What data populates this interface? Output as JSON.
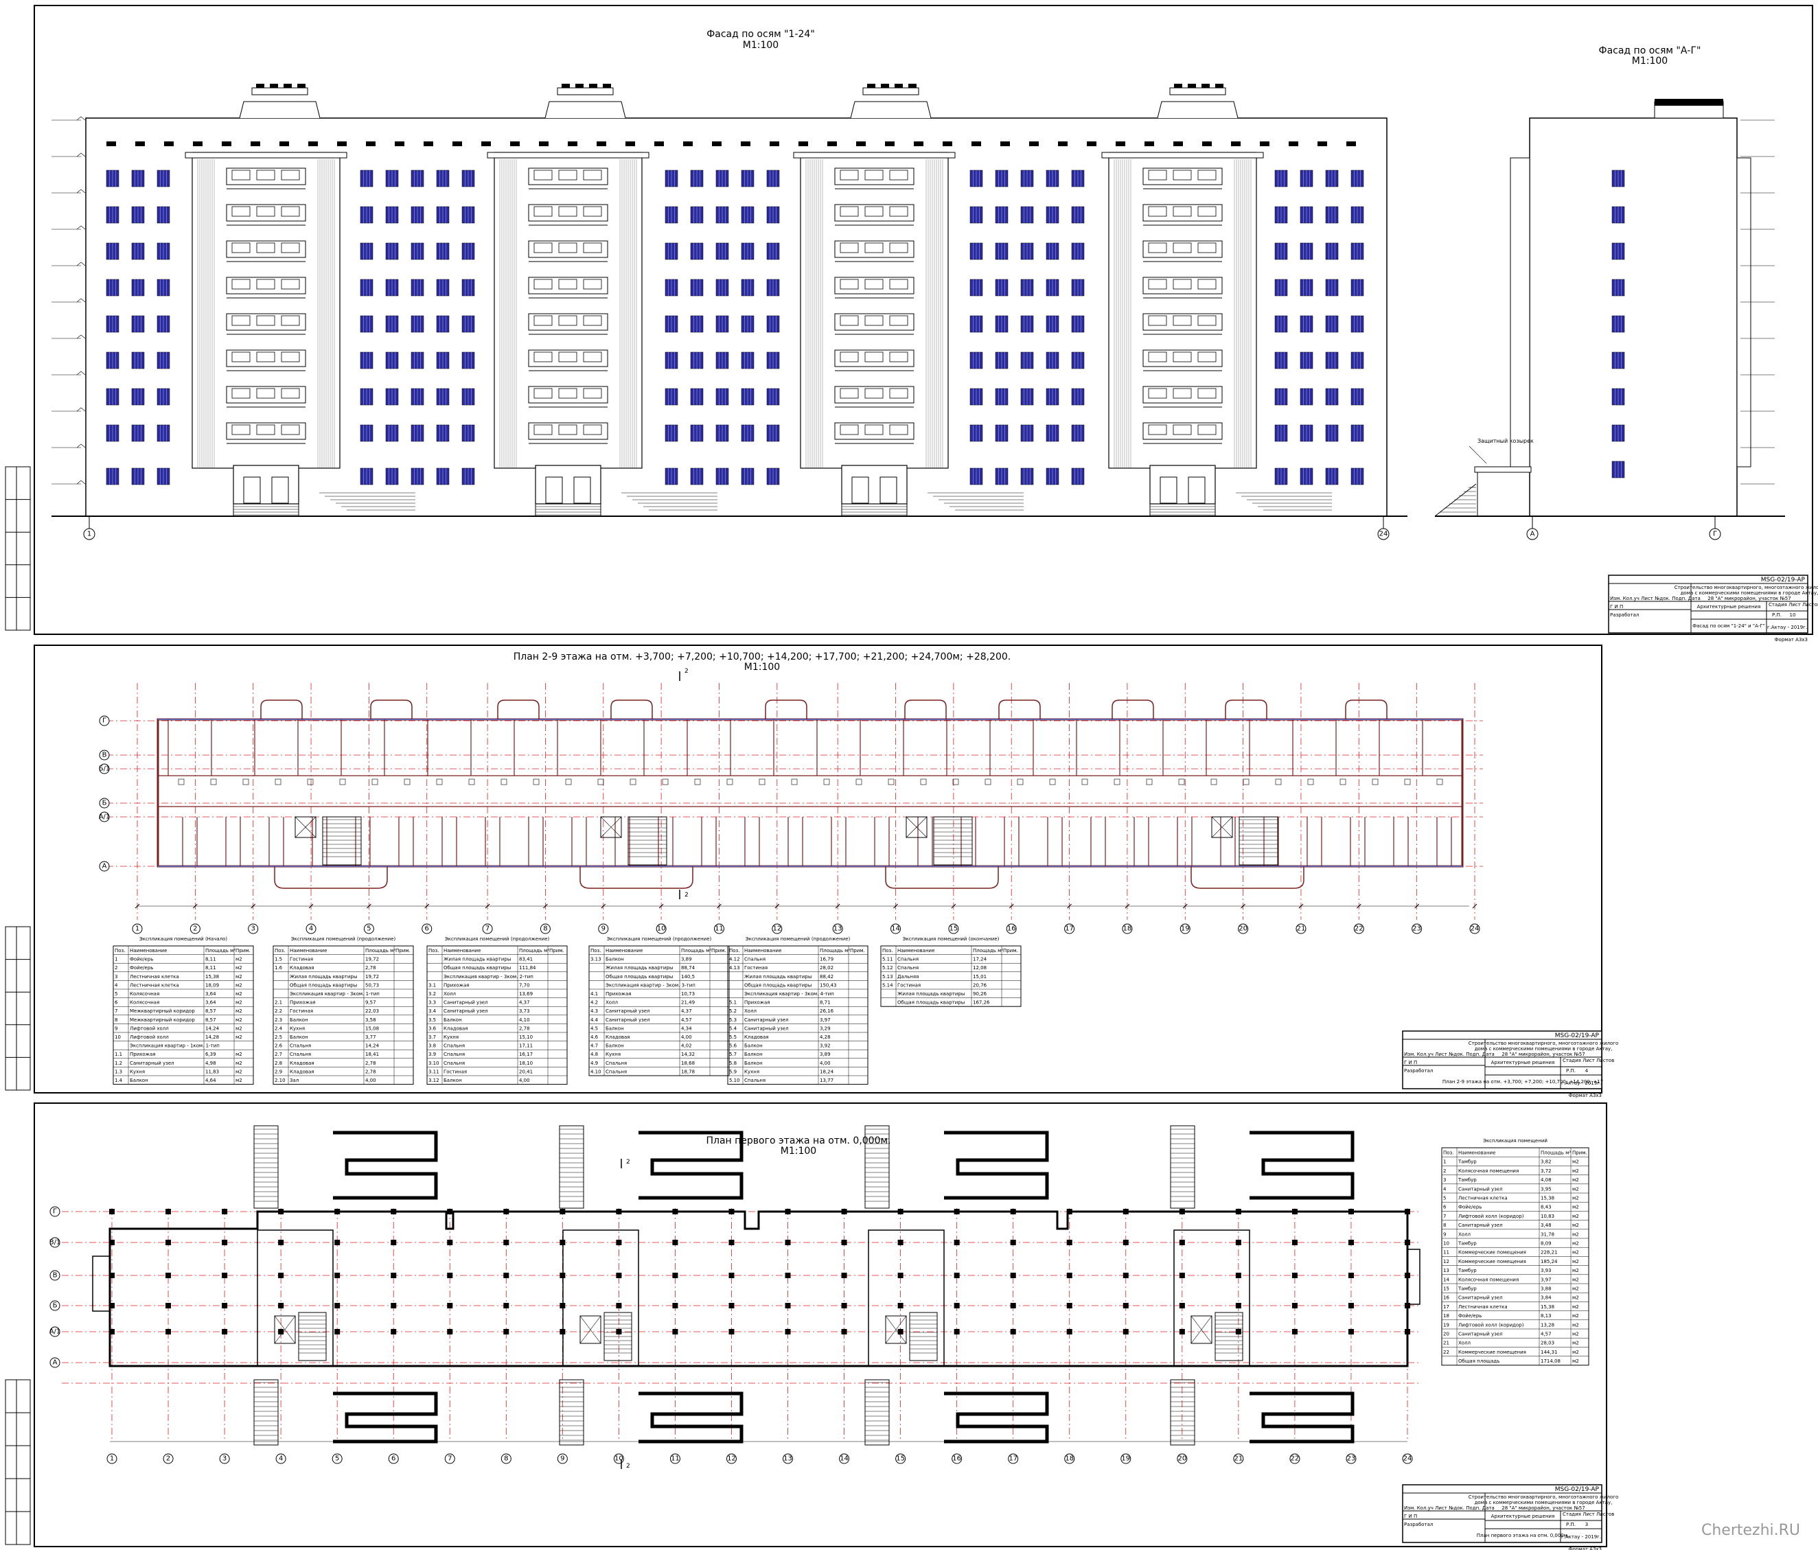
{
  "sheets": {
    "facade": {
      "title_main": "Фасад по осям \"1-24\"",
      "title_scale": "М1:100",
      "title_side": "Фасад по осям \"А-Г\"",
      "title_side_scale": "М1:100",
      "axis_left": "1",
      "axis_right": "24",
      "axis_side_left": "А",
      "axis_side_right": "Г",
      "canopy_label": "Защитный козырек",
      "titleblock": {
        "code": "MSG-02/19-AP",
        "desc1": "Строительство многоквартирного, многоэтажного жилого",
        "desc2": "дома с коммерческими помещениями в городе Актау,",
        "desc3": "28 \"А\" микрорайон, участок №57",
        "section": "Архитектурные решения",
        "stage": "Р.П.",
        "sheet": "10",
        "sheet_name": "Фасад по осям \"1-24\" и \"А-Г\"",
        "company": "г.Актау - 2019г.",
        "format": "Формат А3х3",
        "developed": "Разработал"
      }
    },
    "plan_typical": {
      "title_main": "План 2-9 этажа на отм. +3,700; +7,200; +10,700; +14,200; +17,700; +21,200; +24,700м; +28,200.",
      "title_scale": "М1:100",
      "cut_label": "2",
      "axes_bottom": [
        "1",
        "2",
        "3",
        "4",
        "5",
        "6",
        "7",
        "8",
        "9",
        "10",
        "11",
        "12",
        "13",
        "14",
        "15",
        "16",
        "17",
        "18",
        "19",
        "20",
        "21",
        "22",
        "23",
        "24"
      ],
      "axes_left": [
        "Г",
        "В",
        "Б/1",
        "Б",
        "А/1",
        "А"
      ],
      "tables": [
        {
          "title": "Экспликация помещений (Начало)",
          "headers": [
            "Поз.",
            "Наименование",
            "Площадь м²",
            "Прим."
          ],
          "rows": [
            [
              "1",
              "Фойе/ерь",
              "8,11",
              "м2"
            ],
            [
              "2",
              "Фойе/ерь",
              "8,11",
              "м2"
            ],
            [
              "3",
              "Лестничная клетка",
              "15,38",
              "м2"
            ],
            [
              "4",
              "Лестничная клетка",
              "18,09",
              "м2"
            ],
            [
              "5",
              "Колясочная",
              "3,64",
              "м2"
            ],
            [
              "6",
              "Колясочная",
              "3,64",
              "м2"
            ],
            [
              "7",
              "Межквартирный коридор",
              "8,57",
              "м2"
            ],
            [
              "8",
              "Межквартирный коридор",
              "8,57",
              "м2"
            ],
            [
              "9",
              "Лифтовой холл",
              "14,24",
              "м2"
            ],
            [
              "10",
              "Лифтовой холл",
              "14,28",
              "м2"
            ],
            [
              "",
              "Экспликация квартир - 1ком. 1-тип",
              "",
              ""
            ],
            [
              "1.1",
              "Прихожая",
              "6,39",
              "м2"
            ],
            [
              "1.2",
              "Санитарный узел",
              "4,98",
              "м2"
            ],
            [
              "1.3",
              "Кухня",
              "11,83",
              "м2"
            ],
            [
              "1.4",
              "Балкон",
              "4,64",
              "м2"
            ]
          ]
        },
        {
          "title": "Экспликация помещений (продолжение)",
          "headers": [
            "Поз.",
            "Наименование",
            "Площадь м²",
            "Прим."
          ],
          "rows": [
            [
              "1.5",
              "Гостиная",
              "19,72",
              ""
            ],
            [
              "1.6",
              "Кладовая",
              "2,78",
              ""
            ],
            [
              "",
              "Жилая площадь квартиры",
              "19,72",
              ""
            ],
            [
              "",
              "Общая площадь квартиры",
              "50,73",
              ""
            ],
            [
              "",
              "Экспликация квартир - 3ком. 1-тип",
              "",
              ""
            ],
            [
              "2.1",
              "Прихожая",
              "9,57",
              ""
            ],
            [
              "2.2",
              "Гостиная",
              "22,03",
              ""
            ],
            [
              "2.3",
              "Балкон",
              "3,58",
              ""
            ],
            [
              "2.4",
              "Кухня",
              "15,08",
              ""
            ],
            [
              "2.5",
              "Балкон",
              "3,77",
              ""
            ],
            [
              "2.6",
              "Спальня",
              "14,24",
              ""
            ],
            [
              "2.7",
              "Спальня",
              "18,41",
              ""
            ],
            [
              "2.8",
              "Кладовая",
              "2,78",
              ""
            ],
            [
              "2.9",
              "Кладовая",
              "2,78",
              ""
            ],
            [
              "2.10",
              "Зал",
              "4,00",
              ""
            ]
          ]
        },
        {
          "title": "Экспликация помещений (продолжение)",
          "headers": [
            "Поз.",
            "Наименование",
            "Площадь м²",
            "Прим."
          ],
          "rows": [
            [
              "",
              "Жилая площадь квартиры",
              "83,41",
              ""
            ],
            [
              "",
              "Общая площадь квартиры",
              "111,84",
              ""
            ],
            [
              "",
              "Экспликация квартир - 3ком. 2-тип",
              "",
              ""
            ],
            [
              "3.1",
              "Прихожая",
              "7,70",
              ""
            ],
            [
              "3.2",
              "Холл",
              "13,69",
              ""
            ],
            [
              "3.3",
              "Санитарный узел",
              "4,37",
              ""
            ],
            [
              "3.4",
              "Санитарный узел",
              "3,73",
              ""
            ],
            [
              "3.5",
              "Балкон",
              "4,10",
              ""
            ],
            [
              "3.6",
              "Кладовая",
              "2,78",
              ""
            ],
            [
              "3.7",
              "Кухня",
              "15,10",
              ""
            ],
            [
              "3.8",
              "Спальня",
              "17,11",
              ""
            ],
            [
              "3.9",
              "Спальня",
              "16,17",
              ""
            ],
            [
              "3.10",
              "Спальня",
              "18,10",
              ""
            ],
            [
              "3.11",
              "Гостиная",
              "20,41",
              ""
            ],
            [
              "3.12",
              "Балкон",
              "4,00",
              ""
            ]
          ]
        },
        {
          "title": "Экспликация помещений (продолжение)",
          "headers": [
            "Поз.",
            "Наименование",
            "Площадь м²",
            "Прим."
          ],
          "rows": [
            [
              "3.13",
              "Балкон",
              "3,89",
              ""
            ],
            [
              "",
              "Жилая площадь квартиры",
              "88,74",
              ""
            ],
            [
              "",
              "Общая площадь квартиры",
              "140,5",
              ""
            ],
            [
              "",
              "Экспликация квартир - 3ком. 3-тип",
              "",
              ""
            ],
            [
              "4.1",
              "Прихожая",
              "10,73",
              ""
            ],
            [
              "4.2",
              "Холл",
              "21,49",
              ""
            ],
            [
              "4.3",
              "Санитарный узел",
              "4,37",
              ""
            ],
            [
              "4.4",
              "Санитарный узел",
              "4,57",
              ""
            ],
            [
              "4.5",
              "Балкон",
              "4,34",
              ""
            ],
            [
              "4.6",
              "Кладовая",
              "4,00",
              ""
            ],
            [
              "4.7",
              "Балкон",
              "4,02",
              ""
            ],
            [
              "4.8",
              "Кухня",
              "14,32",
              ""
            ],
            [
              "4.9",
              "Спальня",
              "18,68",
              ""
            ],
            [
              "4.10",
              "Спальня",
              "18,78",
              ""
            ]
          ]
        },
        {
          "title": "Экспликация помещений (продолжение)",
          "headers": [
            "Поз.",
            "Наименование",
            "Площадь м²",
            "Прим."
          ],
          "rows": [
            [
              "4.12",
              "Спальня",
              "16,79",
              ""
            ],
            [
              "4.13",
              "Гостиная",
              "28,02",
              ""
            ],
            [
              "",
              "Жилая площадь квартиры",
              "88,42",
              ""
            ],
            [
              "",
              "Общая площадь квартиры",
              "150,43",
              ""
            ],
            [
              "",
              "Экспликация квартир - 3ком. 4-тип",
              "",
              ""
            ],
            [
              "5.1",
              "Прихожая",
              "8,71",
              ""
            ],
            [
              "5.2",
              "Холл",
              "26,16",
              ""
            ],
            [
              "5.3",
              "Санитарный узел",
              "3,97",
              ""
            ],
            [
              "5.4",
              "Санитарный узел",
              "3,29",
              ""
            ],
            [
              "5.5",
              "Кладовая",
              "4,28",
              ""
            ],
            [
              "5.6",
              "Балкон",
              "3,92",
              ""
            ],
            [
              "5.7",
              "Балкон",
              "3,89",
              ""
            ],
            [
              "5.8",
              "Балкон",
              "4,00",
              ""
            ],
            [
              "5.9",
              "Кухня",
              "18,24",
              ""
            ],
            [
              "5.10",
              "Спальня",
              "13,77",
              ""
            ]
          ]
        },
        {
          "title": "Экспликация помещений (окончание)",
          "headers": [
            "Поз.",
            "Наименование",
            "Площадь м²",
            "Прим."
          ],
          "rows": [
            [
              "5.11",
              "Спальня",
              "17,24",
              ""
            ],
            [
              "5.12",
              "Спальня",
              "12,08",
              ""
            ],
            [
              "5.13",
              "Дальняя",
              "15,01",
              ""
            ],
            [
              "5.14",
              "Гостиная",
              "20,76",
              ""
            ],
            [
              "",
              "Жилая площадь квартиры",
              "90,26",
              ""
            ],
            [
              "",
              "Общая площадь квартиры",
              "167,26",
              ""
            ]
          ]
        }
      ],
      "titleblock": {
        "code": "MSG-02/19-AP",
        "desc1": "Строительство многоквартирного, многоэтажного жилого",
        "desc2": "дома с коммерческими помещениями в городе Актау,",
        "desc3": "28 \"А\" микрорайон, участок №57",
        "section": "Архитектурные решения",
        "stage": "Р.П.",
        "sheet": "4",
        "sheet_name": "План 2-9 этажа на отм. +3,700; +7,200; +10,700; +14,200; +17,700; +21,200; +24,700м; +28,200.",
        "company": "г.Актау - 2019г.",
        "format": "Формат А3х3",
        "developed": "Разработал"
      }
    },
    "plan_ground": {
      "title_main": "План первого этажа на отм. 0,000м.",
      "title_scale": "М1:100",
      "cut_label": "2",
      "axes_bottom": [
        "1",
        "2",
        "3",
        "4",
        "5",
        "6",
        "7",
        "8",
        "9",
        "10",
        "11",
        "12",
        "13",
        "14",
        "15",
        "16",
        "17",
        "18",
        "19",
        "20",
        "21",
        "22",
        "23",
        "24"
      ],
      "axes_left": [
        "Г",
        "В/1",
        "В",
        "Б",
        "А/1",
        "А"
      ],
      "table": {
        "title": "Экспликация помещений",
        "headers": [
          "Поз.",
          "Наименование",
          "Площадь м²",
          "Прим."
        ],
        "rows": [
          [
            "1",
            "Тамбур",
            "3,82",
            "м2"
          ],
          [
            "2",
            "Колясочная помещения",
            "3,72",
            "м2"
          ],
          [
            "3",
            "Тамбур",
            "4,08",
            "м2"
          ],
          [
            "4",
            "Санитарный узел",
            "3,95",
            "м2"
          ],
          [
            "5",
            "Лестничная клетка",
            "15,38",
            "м2"
          ],
          [
            "6",
            "Фойе/ерь",
            "8,43",
            "м2"
          ],
          [
            "7",
            "Лифтовой холл (коридор)",
            "10,83",
            "м2"
          ],
          [
            "8",
            "Санитарный узел",
            "3,48",
            "м2"
          ],
          [
            "9",
            "Холл",
            "31,78",
            "м2"
          ],
          [
            "10",
            "Тамбур",
            "8,09",
            "м2"
          ],
          [
            "11",
            "Коммерческие помещения",
            "228,21",
            "м2"
          ],
          [
            "12",
            "Коммерческие помещения",
            "185,24",
            "м2"
          ],
          [
            "13",
            "Тамбур",
            "3,93",
            "м2"
          ],
          [
            "14",
            "Колясочная помещения",
            "3,97",
            "м2"
          ],
          [
            "15",
            "Тамбур",
            "3,88",
            "м2"
          ],
          [
            "16",
            "Санитарный узел",
            "3,84",
            "м2"
          ],
          [
            "17",
            "Лестничная клетка",
            "15,38",
            "м2"
          ],
          [
            "18",
            "Фойе/ерь",
            "8,13",
            "м2"
          ],
          [
            "19",
            "Лифтовой холл (коридор)",
            "13,28",
            "м2"
          ],
          [
            "20",
            "Санитарный узел",
            "4,57",
            "м2"
          ],
          [
            "21",
            "Холл",
            "28,03",
            "м2"
          ],
          [
            "22",
            "Коммерческие помещения",
            "144,31",
            "м2"
          ],
          [
            "",
            "Общая площадь",
            "1714,08",
            "м2"
          ]
        ]
      },
      "titleblock": {
        "code": "MSG-02/19-AP",
        "desc1": "Строительство многоквартирного, многоэтажного жилого",
        "desc2": "дома с коммерческими помещениями в городе Актау,",
        "desc3": "28 \"А\" микрорайон, участок №57",
        "section": "Архитектурные решения",
        "stage": "Р.П.",
        "sheet": "3",
        "sheet_name": "План первого этажа на отм. 0,000м.",
        "company": "г.Актау - 2019г.",
        "format": "Формат А3х3",
        "developed": "Разработал"
      }
    }
  },
  "titleblock_labels": {
    "izm": "Изм.",
    "kol": "Кол.уч",
    "list": "Лист",
    "ndok": "№док.",
    "podp": "Подп.",
    "data": "Дата",
    "stadiya": "Стадия",
    "list2": "Лист",
    "listov": "Листов",
    "gip": "Г И П"
  },
  "watermark": "Chertezhi.RU",
  "colors": {
    "window": "#2b2b9a",
    "axis": "#e02020",
    "line": "#000000",
    "wall": "#7a1f1f"
  }
}
